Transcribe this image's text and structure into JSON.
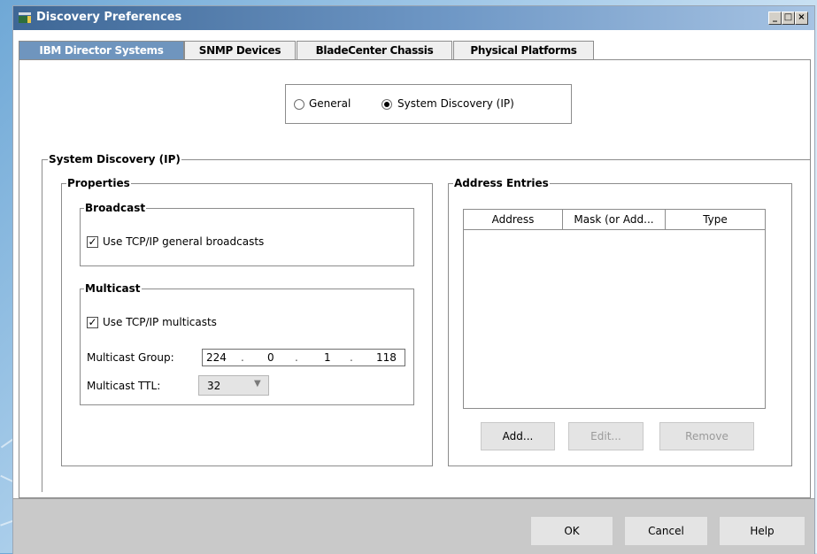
{
  "window": {
    "title": "Discovery Preferences",
    "controls": {
      "minimize": "_",
      "maximize": "□",
      "close": "×"
    }
  },
  "tabs": [
    {
      "label": "IBM Director Systems",
      "active": true
    },
    {
      "label": "SNMP Devices",
      "active": false
    },
    {
      "label": "BladeCenter Chassis",
      "active": false
    },
    {
      "label": "Physical Platforms",
      "active": false
    }
  ],
  "mode": {
    "options": [
      {
        "label": "General",
        "selected": false
      },
      {
        "label": "System Discovery (IP)",
        "selected": true
      }
    ]
  },
  "system_discovery": {
    "title": "System Discovery (IP)",
    "properties": {
      "title": "Properties",
      "broadcast": {
        "title": "Broadcast",
        "checkbox_label": "Use TCP/IP general broadcasts",
        "checked": true
      },
      "multicast": {
        "title": "Multicast",
        "checkbox_label": "Use TCP/IP multicasts",
        "checked": true,
        "group_label": "Multicast Group:",
        "group_octets": [
          "224",
          "0",
          "1",
          "118"
        ],
        "ttl_label": "Multicast TTL:",
        "ttl_value": "32"
      }
    },
    "address_entries": {
      "title": "Address Entries",
      "columns": [
        "Address",
        "Mask (or Add...",
        "Type"
      ],
      "rows": [],
      "buttons": {
        "add": "Add...",
        "edit": "Edit...",
        "remove": "Remove"
      }
    }
  },
  "footer": {
    "ok": "OK",
    "cancel": "Cancel",
    "help": "Help"
  },
  "colors": {
    "active_tab": "#6f95be",
    "titlebar_start": "#3e6796",
    "footer_bg": "#c9c9c9"
  }
}
